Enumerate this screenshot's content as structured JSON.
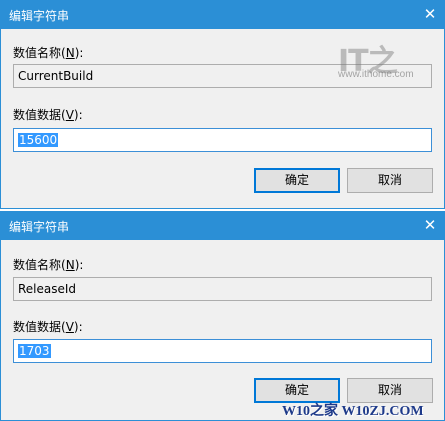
{
  "dialogs": [
    {
      "title": "编辑字符串",
      "close_glyph": "✕",
      "name_label": "数值名称",
      "name_hotkey": "N",
      "name_value": "CurrentBuild",
      "data_label": "数值数据",
      "data_hotkey": "V",
      "data_value": "15600",
      "ok_label": "确定",
      "cancel_label": "取消"
    },
    {
      "title": "编辑字符串",
      "close_glyph": "✕",
      "name_label": "数值名称",
      "name_hotkey": "N",
      "name_value": "ReleaseId",
      "data_label": "数值数据",
      "data_hotkey": "V",
      "data_value": "1703",
      "ok_label": "确定",
      "cancel_label": "取消"
    }
  ],
  "watermark": {
    "logo": "IT之",
    "url": "www.ithome.com",
    "bottom": "W10之家 W10ZJ.COM"
  },
  "colors": {
    "titlebar": "#2b8fd6",
    "dialog_bg": "#f0f0f0",
    "selection": "#3399ff"
  }
}
